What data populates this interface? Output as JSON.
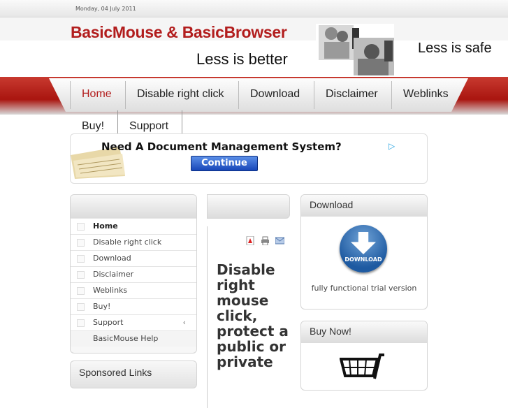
{
  "header": {
    "date": "Monday, 04 July 2011",
    "title": "BasicMouse & BasicBrowser",
    "slogan1": "Less is better",
    "slogan2": "Less is safe"
  },
  "nav": {
    "items": [
      "Home",
      "Disable right click",
      "Download",
      "Disclaimer",
      "Weblinks",
      "Buy!",
      "Support"
    ]
  },
  "ad": {
    "headline": "Need A Document Management System?",
    "button": "Continue",
    "adchoices": "▷"
  },
  "sidebar": {
    "items": [
      "Home",
      "Disable right click",
      "Download",
      "Disclaimer",
      "Weblinks",
      "Buy!",
      "Support",
      "BasicMouse Help"
    ],
    "chevron": "‹",
    "sponsored": "Sponsored Links"
  },
  "main": {
    "title": "Disable right mouse click, protect a public or private"
  },
  "right": {
    "download_title": "Download",
    "download_btn": "DOWNLOAD",
    "trial": "fully functional trial version",
    "buy_title": "Buy Now!"
  },
  "colors": {
    "accent": "#b21d1d",
    "nav_red": "#a9150f"
  }
}
